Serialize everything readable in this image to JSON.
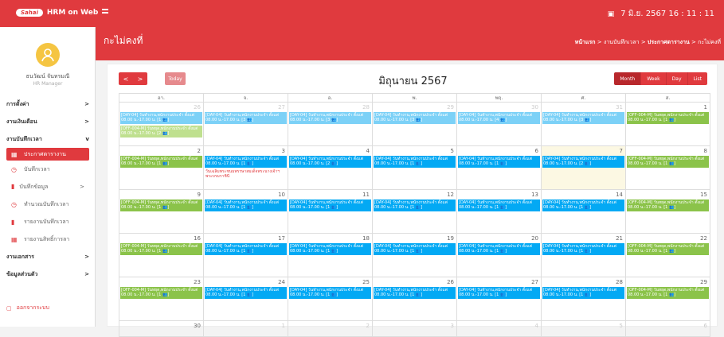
{
  "app": {
    "logo_text": "Sahai",
    "name": "HRM on Web"
  },
  "topbar": {
    "datetime": "7 มิ.ย. 2567  16 : 11 : 11"
  },
  "page": {
    "title": "กะไม่คงที่"
  },
  "breadcrumb": {
    "home": "หน้าแรก",
    "sep1": " > ",
    "level1": "งานบันทึกเวลา",
    "sep2": " > ",
    "level2": "ประกาศตารางาน",
    "sep3": " > ",
    "current": "กะไม่คงที่"
  },
  "user": {
    "name": "ธนวัฒน์ จันทรมณี",
    "role": "HR Manager"
  },
  "sidebar": {
    "items": [
      {
        "label": "การตั้งค่า",
        "arrow": ">"
      },
      {
        "label": "งานเงินเดือน",
        "arrow": ">"
      },
      {
        "label": "งานบันทึกเวลา",
        "arrow": "v"
      }
    ],
    "sub": [
      {
        "label": "ประกาศตารางาน",
        "icon": "▦"
      },
      {
        "label": "บันทึกเวลา",
        "icon": "◷"
      },
      {
        "label": "บันทึกข้อมูล",
        "icon": "▮",
        "arrow": ">"
      },
      {
        "label": "ทำนวณบันทึกเวลา",
        "icon": "◷"
      },
      {
        "label": "รายงานบันทึกเวลา",
        "icon": "▮"
      },
      {
        "label": "รายงานสิทธิ์การลา",
        "icon": "▦"
      }
    ],
    "items2": [
      {
        "label": "งานเอกสาร",
        "arrow": ">"
      },
      {
        "label": "ข้อมูลส่วนตัว",
        "arrow": ">"
      }
    ],
    "logout": "ออกจากระบบ"
  },
  "toolbar": {
    "prev": "<",
    "next": ">",
    "today": "Today",
    "views": [
      "Month",
      "Week",
      "Day",
      "List"
    ]
  },
  "calendar": {
    "title": "มิถุนายน 2567",
    "headers": [
      "อา.",
      "จ.",
      "อ.",
      "พ.",
      "พฤ.",
      "ศ.",
      "ส."
    ],
    "holiday": "วันเฉลิมพระชนมพรรษาสมเด็จพระนางเจ้าฯ พระบรมราชินี",
    "ev_day04": "[DAY-04] วันทำงาน,พนักงานประจำ ตั้งแต่ 08.00 น.-17.00 น.",
    "ev_off": "[OFF-004-M] วันหยุด,พนักงานประจำ ตั้งแต่ 08.00 น.-17.00 น.",
    "weeks": [
      {
        "days": [
          {
            "n": "26",
            "other": true,
            "events": [
              {
                "t": "day04",
                "f": true,
                "c": "[1 👥]"
              },
              {
                "t": "off",
                "f": true,
                "c": "[2 👥]"
              }
            ]
          },
          {
            "n": "27",
            "other": true,
            "events": [
              {
                "t": "day04",
                "f": true,
                "c": "[3 👥]"
              }
            ]
          },
          {
            "n": "28",
            "other": true,
            "events": [
              {
                "t": "day04",
                "f": true,
                "c": "[3 👥]"
              }
            ]
          },
          {
            "n": "29",
            "other": true,
            "events": [
              {
                "t": "day04",
                "f": true,
                "c": "[3 👥]"
              }
            ]
          },
          {
            "n": "30",
            "other": true,
            "events": [
              {
                "t": "day04",
                "f": true,
                "c": "[4 👥]"
              }
            ]
          },
          {
            "n": "31",
            "other": true,
            "events": [
              {
                "t": "day04",
                "f": true,
                "c": "[3 👥]"
              }
            ]
          },
          {
            "n": "1",
            "events": [
              {
                "t": "off",
                "c": "[1 👥]"
              }
            ]
          }
        ]
      },
      {
        "days": [
          {
            "n": "2",
            "events": [
              {
                "t": "off",
                "c": "[1 👥]"
              }
            ]
          },
          {
            "n": "3",
            "holiday": true,
            "events": [
              {
                "t": "day04",
                "c": "[1 👥]"
              }
            ]
          },
          {
            "n": "4",
            "events": [
              {
                "t": "day04",
                "c": "[2 👥]"
              }
            ]
          },
          {
            "n": "5",
            "events": [
              {
                "t": "day04",
                "c": "[1 👥]"
              }
            ]
          },
          {
            "n": "6",
            "events": [
              {
                "t": "day04",
                "c": "[1 👥]"
              }
            ]
          },
          {
            "n": "7",
            "today": true,
            "events": [
              {
                "t": "day04",
                "c": "[2 👥]"
              }
            ]
          },
          {
            "n": "8",
            "events": [
              {
                "t": "off",
                "c": "[1 👥]"
              }
            ]
          }
        ]
      },
      {
        "days": [
          {
            "n": "9",
            "events": [
              {
                "t": "off",
                "c": "[1 👥]"
              }
            ]
          },
          {
            "n": "10",
            "events": [
              {
                "t": "day04",
                "c": "[1 👥]"
              }
            ]
          },
          {
            "n": "11",
            "events": [
              {
                "t": "day04",
                "c": "[1 👥]"
              }
            ]
          },
          {
            "n": "12",
            "events": [
              {
                "t": "day04",
                "c": "[1 👥]"
              }
            ]
          },
          {
            "n": "13",
            "events": [
              {
                "t": "day04",
                "c": "[1 👥]"
              }
            ]
          },
          {
            "n": "14",
            "events": [
              {
                "t": "day04",
                "c": "[1 👥]"
              }
            ]
          },
          {
            "n": "15",
            "events": [
              {
                "t": "off",
                "c": "[1 👥]"
              }
            ]
          }
        ]
      },
      {
        "days": [
          {
            "n": "16",
            "events": [
              {
                "t": "off",
                "c": "[1 👥]"
              }
            ]
          },
          {
            "n": "17",
            "events": [
              {
                "t": "day04",
                "c": "[1 👥]"
              }
            ]
          },
          {
            "n": "18",
            "events": [
              {
                "t": "day04",
                "c": "[1 👥]"
              }
            ]
          },
          {
            "n": "19",
            "events": [
              {
                "t": "day04",
                "c": "[1 👥]"
              }
            ]
          },
          {
            "n": "20",
            "events": [
              {
                "t": "day04",
                "c": "[1 👥]"
              }
            ]
          },
          {
            "n": "21",
            "events": [
              {
                "t": "day04",
                "c": "[1 👥]"
              }
            ]
          },
          {
            "n": "22",
            "events": [
              {
                "t": "off",
                "c": "[1 👥]"
              }
            ]
          }
        ]
      },
      {
        "days": [
          {
            "n": "23",
            "events": [
              {
                "t": "off",
                "c": "[1 👥]"
              }
            ]
          },
          {
            "n": "24",
            "events": [
              {
                "t": "day04",
                "c": "[1 👥]"
              }
            ]
          },
          {
            "n": "25",
            "events": [
              {
                "t": "day04",
                "c": "[1 👥]"
              }
            ]
          },
          {
            "n": "26",
            "events": [
              {
                "t": "day04",
                "c": "[1 👥]"
              }
            ]
          },
          {
            "n": "27",
            "events": [
              {
                "t": "day04",
                "c": "[1 👥]"
              }
            ]
          },
          {
            "n": "28",
            "events": [
              {
                "t": "day04",
                "c": "[1 👥]"
              }
            ]
          },
          {
            "n": "29",
            "events": [
              {
                "t": "off",
                "c": "[1 👥]"
              }
            ]
          }
        ]
      },
      {
        "last": true,
        "days": [
          {
            "n": "30",
            "events": []
          },
          {
            "n": "1",
            "other": true,
            "events": []
          },
          {
            "n": "2",
            "other": true,
            "events": []
          },
          {
            "n": "3",
            "other": true,
            "events": []
          },
          {
            "n": "4",
            "other": true,
            "events": []
          },
          {
            "n": "5",
            "other": true,
            "events": []
          },
          {
            "n": "6",
            "other": true,
            "events": []
          }
        ]
      }
    ]
  },
  "colors": {
    "brand": "#e03a3e",
    "work_event": "#03a9f4",
    "off_event": "#8bc34a",
    "today": "#fcf8e3"
  }
}
